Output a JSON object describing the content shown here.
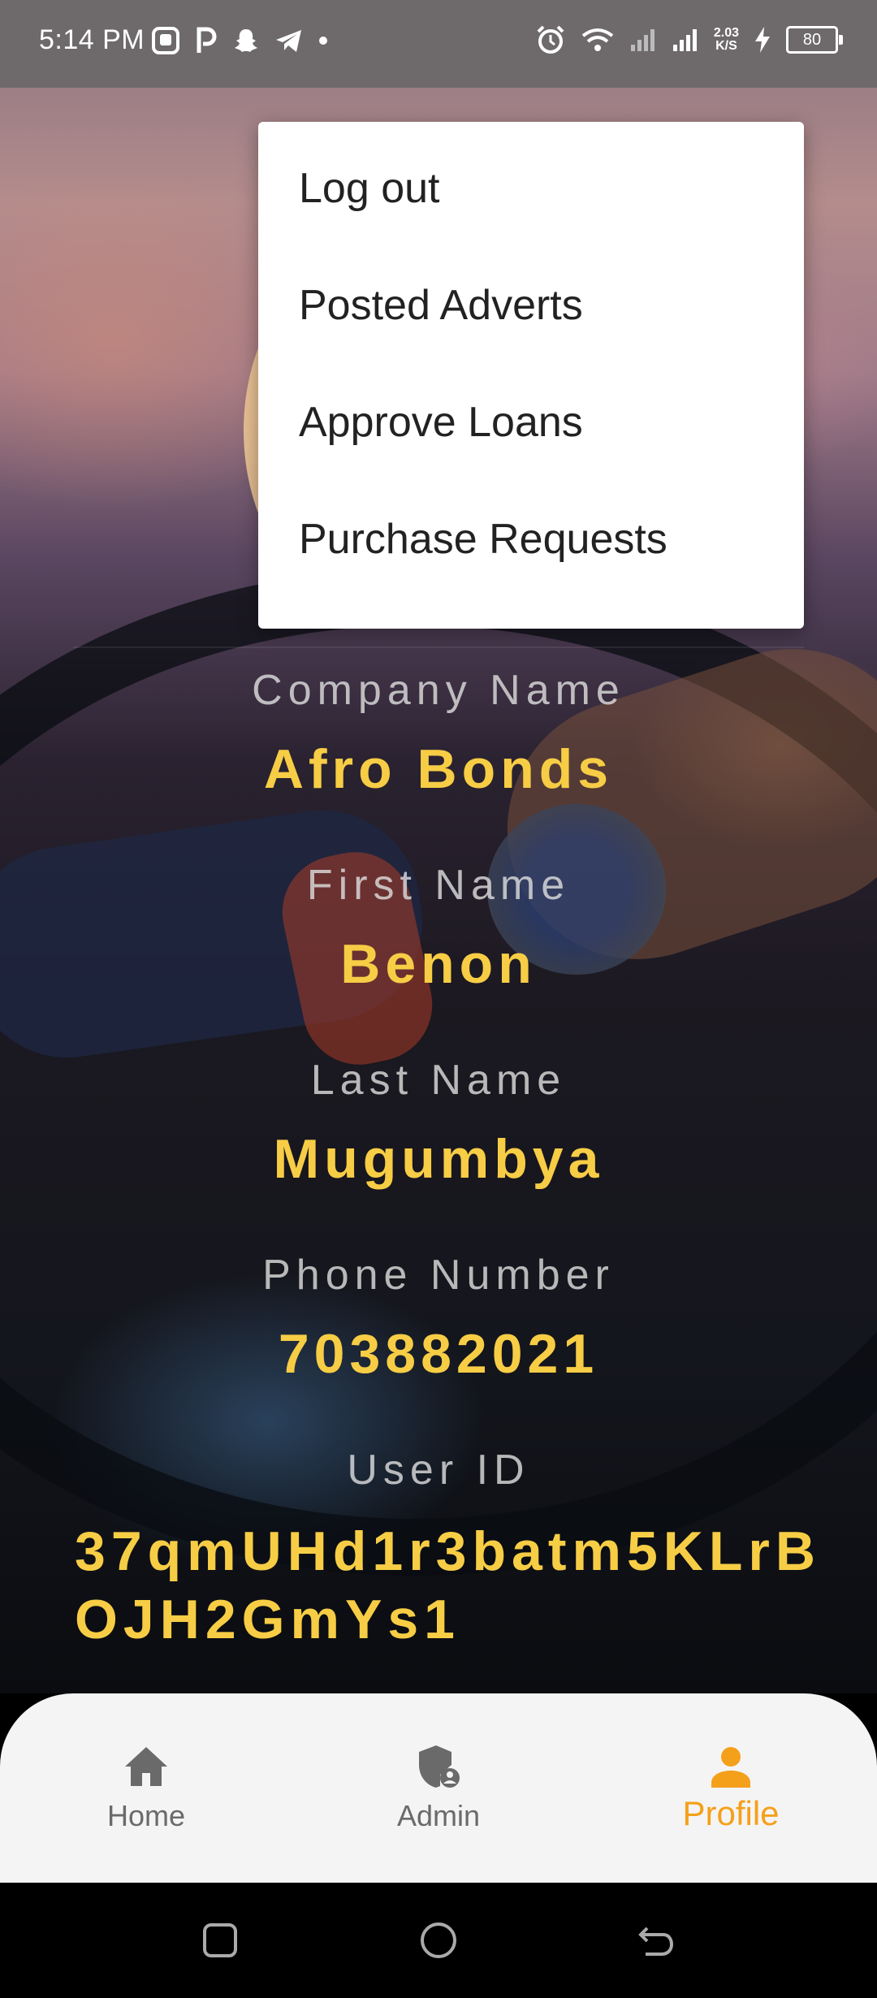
{
  "status_bar": {
    "time": "5:14 PM",
    "left_icons": [
      "app-icon",
      "p-icon",
      "snapchat-icon",
      "telegram-icon",
      "dot-icon"
    ],
    "net_speed_value": "2.03",
    "net_speed_unit": "K/S",
    "battery": "80"
  },
  "menu": {
    "items": [
      {
        "label": "Log out"
      },
      {
        "label": "Posted Adverts"
      },
      {
        "label": "Approve Loans"
      },
      {
        "label": "Purchase Requests"
      }
    ]
  },
  "profile": {
    "company_label": "Company Name",
    "company_value": "Afro Bonds",
    "first_name_label": "First Name",
    "first_name_value": "Benon",
    "last_name_label": "Last Name",
    "last_name_value": "Mugumbya",
    "phone_label": "Phone Number",
    "phone_value": "703882021",
    "user_id_label": "User ID",
    "user_id_value": "37qmUHd1r3batm5KLrBOJH2GmYs1"
  },
  "bottom_nav": {
    "items": [
      {
        "label": "Home",
        "icon": "home-icon"
      },
      {
        "label": "Admin",
        "icon": "admin-shield-icon"
      },
      {
        "label": "Profile",
        "icon": "person-icon",
        "active": true
      }
    ],
    "active_color": "#f5a01a",
    "inactive_color": "#6a6a6a"
  },
  "colors": {
    "value_yellow": "#f7cd45",
    "status_bar": "#6e6a6c"
  }
}
